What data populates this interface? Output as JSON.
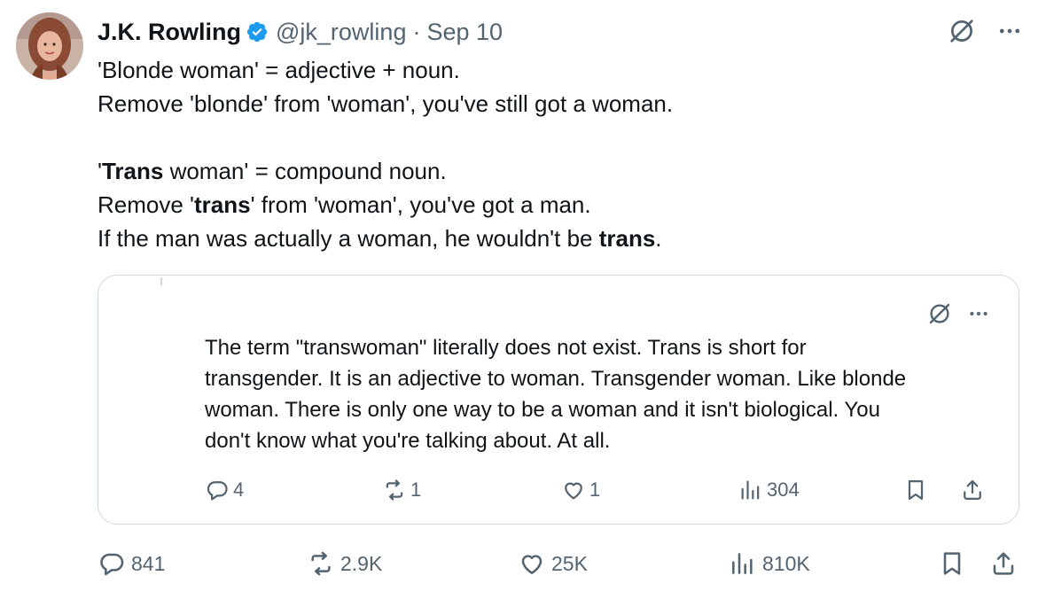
{
  "author": {
    "name": "J.K. Rowling",
    "handle": "@jk_rowling",
    "separator": "·",
    "date": "Sep 10",
    "verified": true
  },
  "tweet": {
    "lines": [
      "'Blonde woman' = adjective + noun.",
      "Remove 'blonde' from 'woman', you've still got a woman.",
      "",
      "'Trans woman' = compound noun.",
      "Remove 'trans' from 'woman', you've got a man.",
      "If the man was actually a woman, he wouldn't be trans."
    ],
    "bold_word": "trans",
    "line4": {
      "q": "'",
      "b": "Trans",
      "rest": " woman' = compound noun."
    },
    "line5": {
      "pre": "Remove '",
      "b": "trans",
      "rest": "' from 'woman', you've got a man."
    },
    "line6": {
      "pre": "If the man was actually a woman, he wouldn't be ",
      "b": "trans",
      "rest": "."
    }
  },
  "quoted_tweet": {
    "lines": [
      "The term \"transwoman\" literally does not exist. Trans is short for",
      "transgender. It is an adjective to woman. Transgender woman. Like blonde",
      "woman. There is only one way to be a woman and it isn't biological. You",
      "don't know what you're talking about. At all."
    ],
    "metrics": {
      "replies": "4",
      "reposts": "1",
      "likes": "1",
      "views": "304"
    }
  },
  "metrics": {
    "replies": "841",
    "reposts": "2.9K",
    "likes": "25K",
    "views": "810K"
  },
  "icons": {
    "reply": "reply-icon",
    "repost": "repost-icon",
    "like": "heart-icon",
    "views": "views-icon",
    "bookmark": "bookmark-icon",
    "share": "share-icon",
    "grok": "grok-icon",
    "more": "more-icon",
    "verified": "verified-badge-icon"
  },
  "colors": {
    "text": "#0f1419",
    "secondary": "#536471",
    "verified": "#1d9bf0",
    "border": "#cfd9de"
  }
}
